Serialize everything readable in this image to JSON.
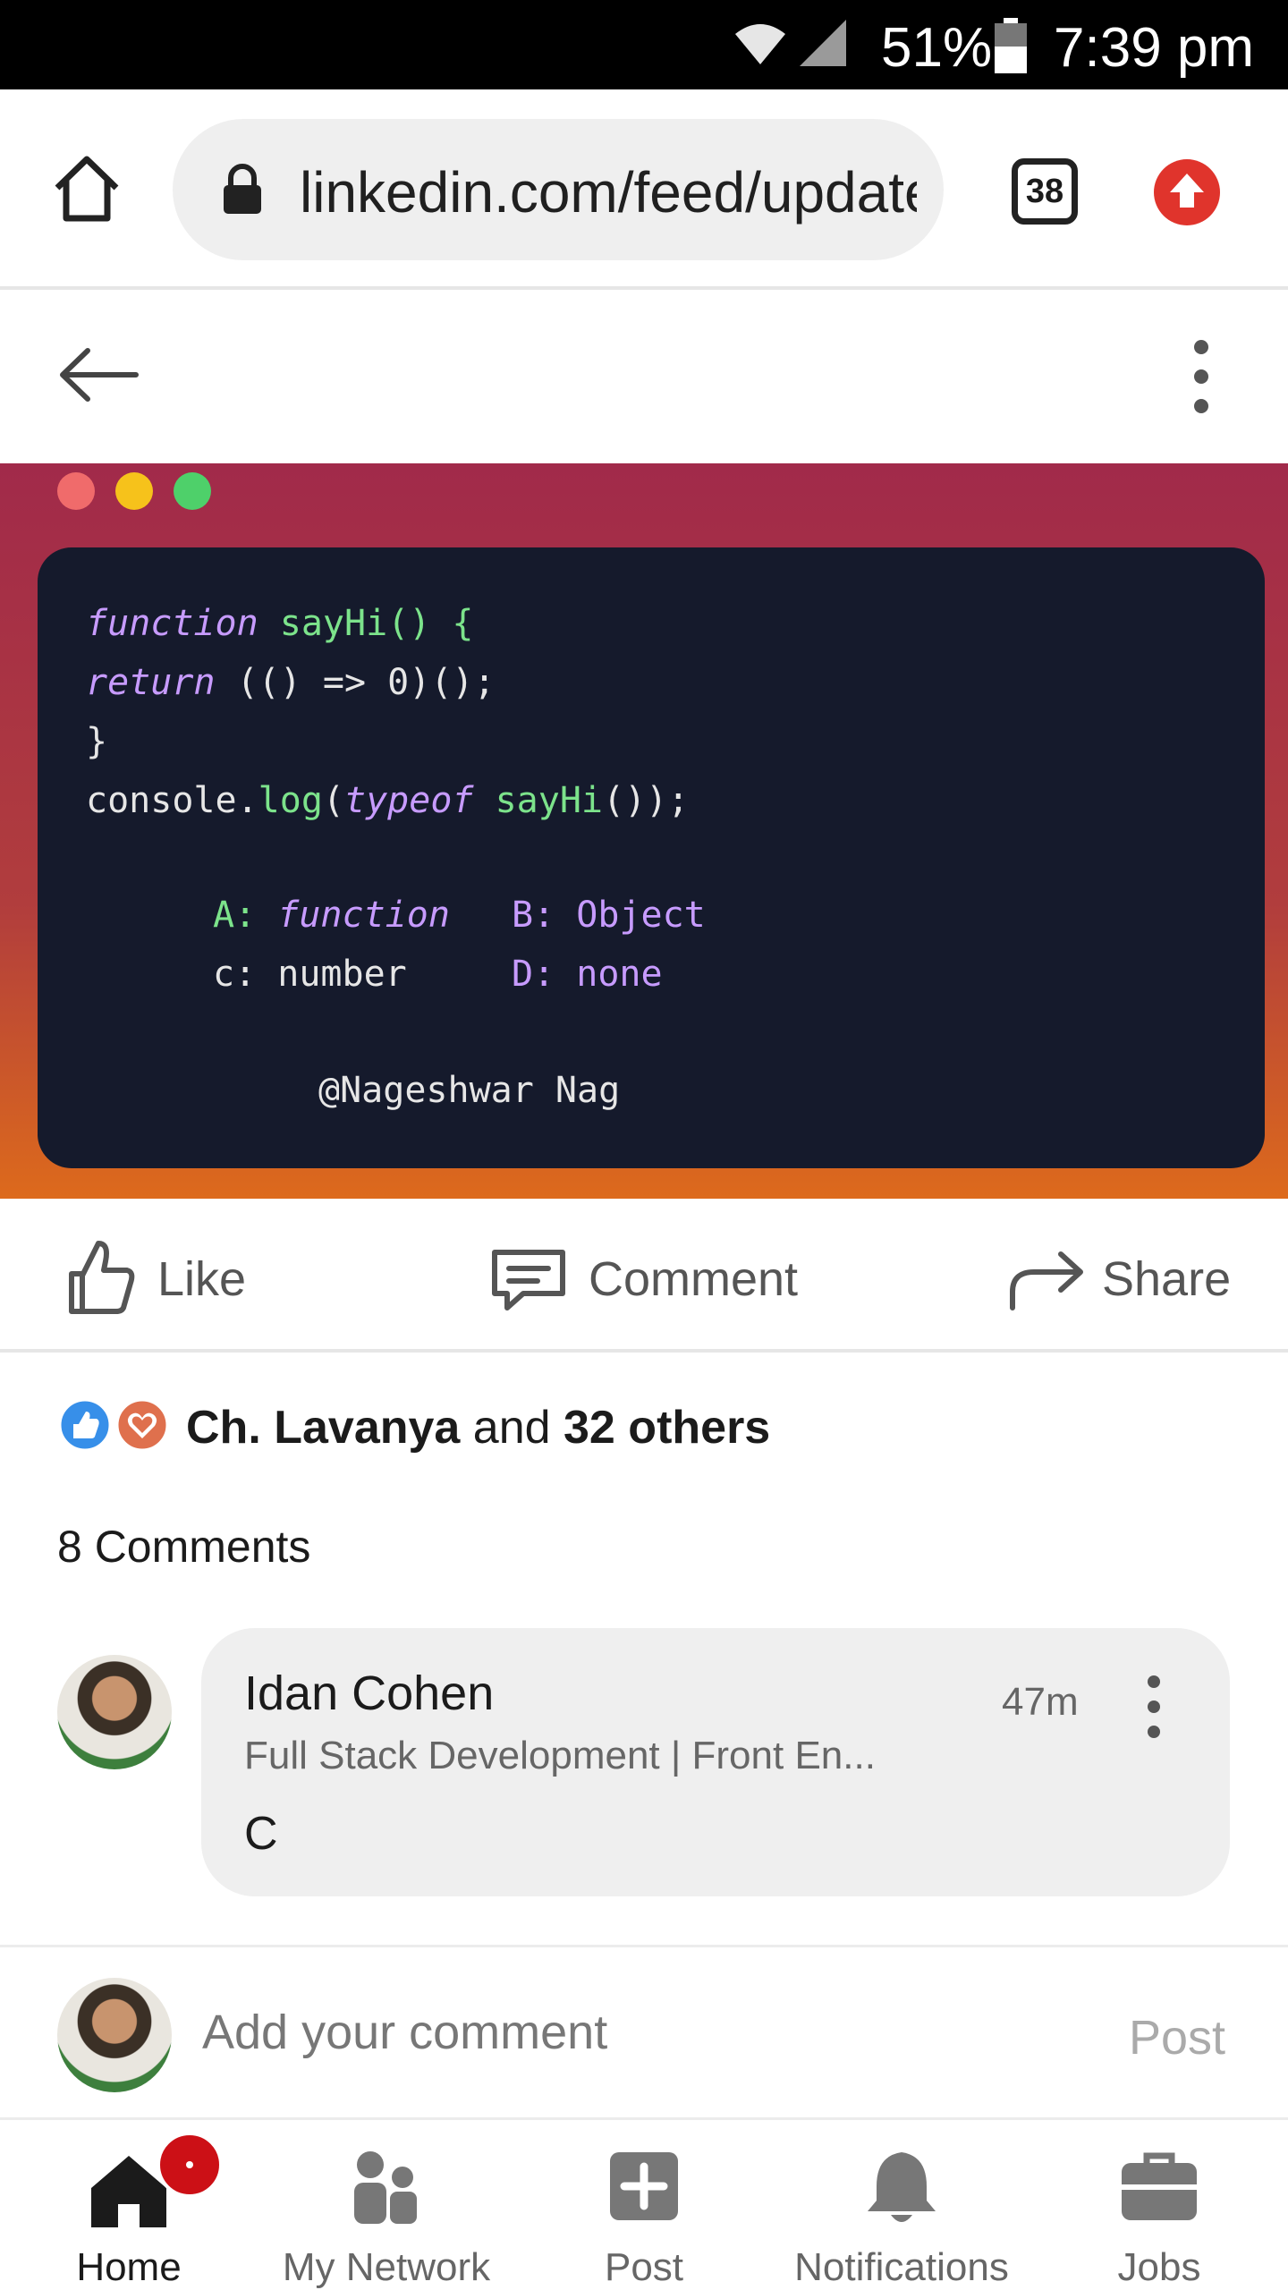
{
  "status_bar": {
    "battery": "51%",
    "time": "7:39 pm"
  },
  "browser": {
    "url": "linkedin.com/feed/update",
    "tab_count": "38"
  },
  "code_snippet": {
    "line1_kw": "function",
    "line1_rest": "sayHi() {",
    "line2_kw": "return",
    "line2_rest": "(() => 0)();",
    "line3": "}",
    "line4_a": "console.",
    "line4_b": "log",
    "line4_c": "(",
    "line4_kw": "typeof",
    "line4_d": "sayHi",
    "line4_e": "());",
    "opt_a_label": "A:",
    "opt_a_value": "function",
    "opt_b": "B: Object",
    "opt_c": "c: number",
    "opt_d": "D: none",
    "author": "@Nageshwar Nag"
  },
  "actions": {
    "like": "Like",
    "comment": "Comment",
    "share": "Share"
  },
  "reactions": {
    "name": "Ch. Lavanya",
    "and": "and",
    "others": "32 others"
  },
  "comments": {
    "count_label": "8 Comments",
    "items": [
      {
        "author": "Idan Cohen",
        "headline": "Full Stack Development | Front En...",
        "time": "47m",
        "text": "C"
      }
    ]
  },
  "add_comment": {
    "placeholder": "Add your comment",
    "post_label": "Post"
  },
  "bottom_nav": [
    {
      "label": "Home"
    },
    {
      "label": "My Network"
    },
    {
      "label": "Post"
    },
    {
      "label": "Notifications"
    },
    {
      "label": "Jobs"
    }
  ],
  "colors": {
    "accent_red": "#e0342c",
    "linkedin_blue": "#0a66c2",
    "code_bg": "#151a2c"
  }
}
